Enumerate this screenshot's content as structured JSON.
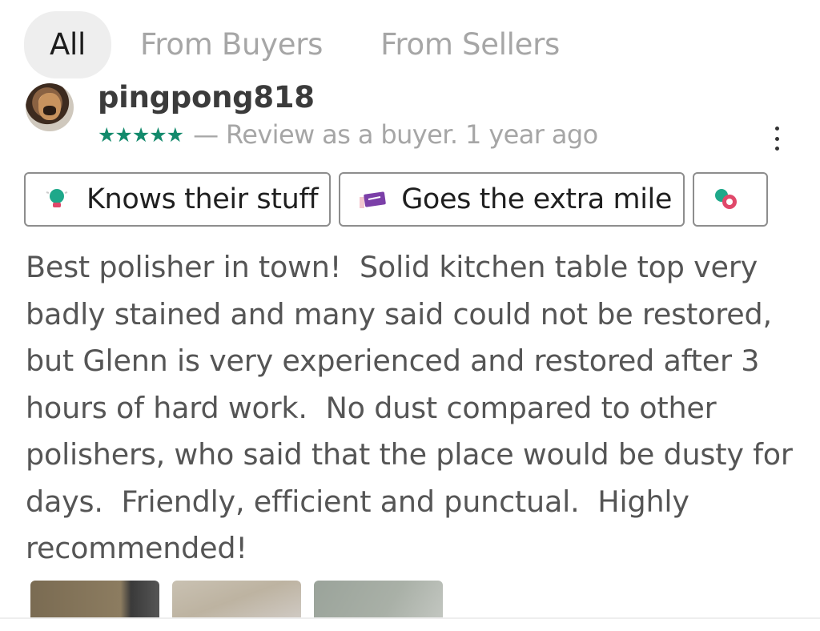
{
  "tabs": [
    {
      "label": "All",
      "active": true
    },
    {
      "label": "From Buyers",
      "active": false
    },
    {
      "label": "From Sellers",
      "active": false
    }
  ],
  "review": {
    "username": "pingpong818",
    "rating": 5,
    "stars": "★★★★★",
    "meta": "— Review as a buyer.  1 year ago",
    "compliments": [
      {
        "icon": "lightbulb-icon",
        "label": "Knows their stuff"
      },
      {
        "icon": "ticket-icon",
        "label": "Goes the extra mile"
      },
      {
        "icon": "badge-icon",
        "label": ""
      }
    ],
    "text": "Best polisher in town!  Solid kitchen table top very badly stained and many said could not be restored, but Glenn is very experienced and restored after 3 hours of hard work.  No dust compared to other polishers, who said that the place would be dusty for days.  Friendly, efficient and punctual.  Highly recommended!",
    "photo_count": 3
  },
  "colors": {
    "star": "#138a6c",
    "muted": "#a6a6a6",
    "active_tab_bg": "#eeeeee"
  }
}
